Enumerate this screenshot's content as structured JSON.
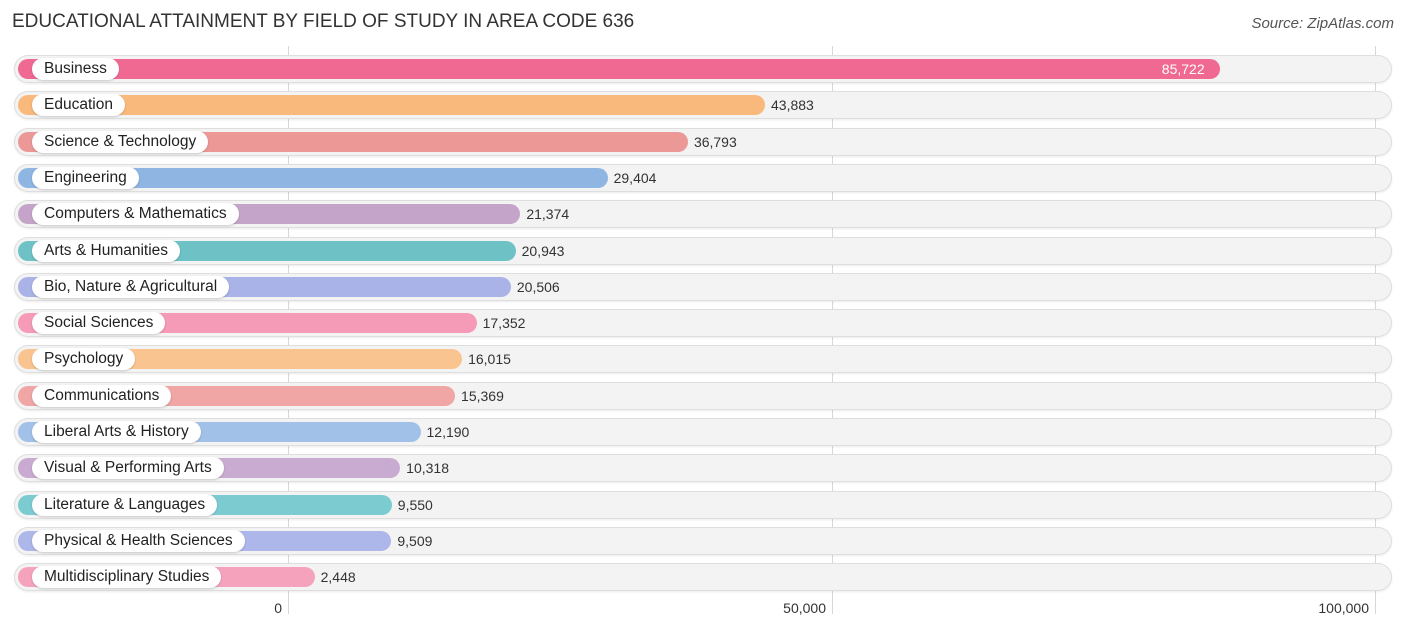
{
  "chart_data": {
    "type": "bar",
    "orientation": "horizontal",
    "title": "EDUCATIONAL ATTAINMENT BY FIELD OF STUDY IN AREA CODE 636",
    "source": "Source: ZipAtlas.com",
    "xlabel": "",
    "ylabel": "",
    "xlim": [
      0,
      100000
    ],
    "xticks": [
      0,
      50000,
      100000
    ],
    "xtick_labels": [
      "0",
      "50,000",
      "100,000"
    ],
    "grid": true,
    "categories": [
      "Business",
      "Education",
      "Science & Technology",
      "Engineering",
      "Computers & Mathematics",
      "Arts & Humanities",
      "Bio, Nature & Agricultural",
      "Social Sciences",
      "Psychology",
      "Communications",
      "Liberal Arts & History",
      "Visual & Performing Arts",
      "Literature & Languages",
      "Physical & Health Sciences",
      "Multidisciplinary Studies"
    ],
    "values": [
      85722,
      43883,
      36793,
      29404,
      21374,
      20943,
      20506,
      17352,
      16015,
      15369,
      12190,
      10318,
      9550,
      9509,
      2448
    ],
    "value_labels": [
      "85,722",
      "43,883",
      "36,793",
      "29,404",
      "21,374",
      "20,943",
      "20,506",
      "17,352",
      "16,015",
      "15,369",
      "12,190",
      "10,318",
      "9,550",
      "9,509",
      "2,448"
    ],
    "colors": [
      "#f06992",
      "#f9b97c",
      "#ec9896",
      "#8fb6e3",
      "#c4a5c9",
      "#6ec2c6",
      "#aab3e8",
      "#f59bb8",
      "#f9c48f",
      "#efa6a4",
      "#a2c1e8",
      "#c9abd2",
      "#7ccbd1",
      "#aeb7ea",
      "#f5a3bd"
    ]
  }
}
